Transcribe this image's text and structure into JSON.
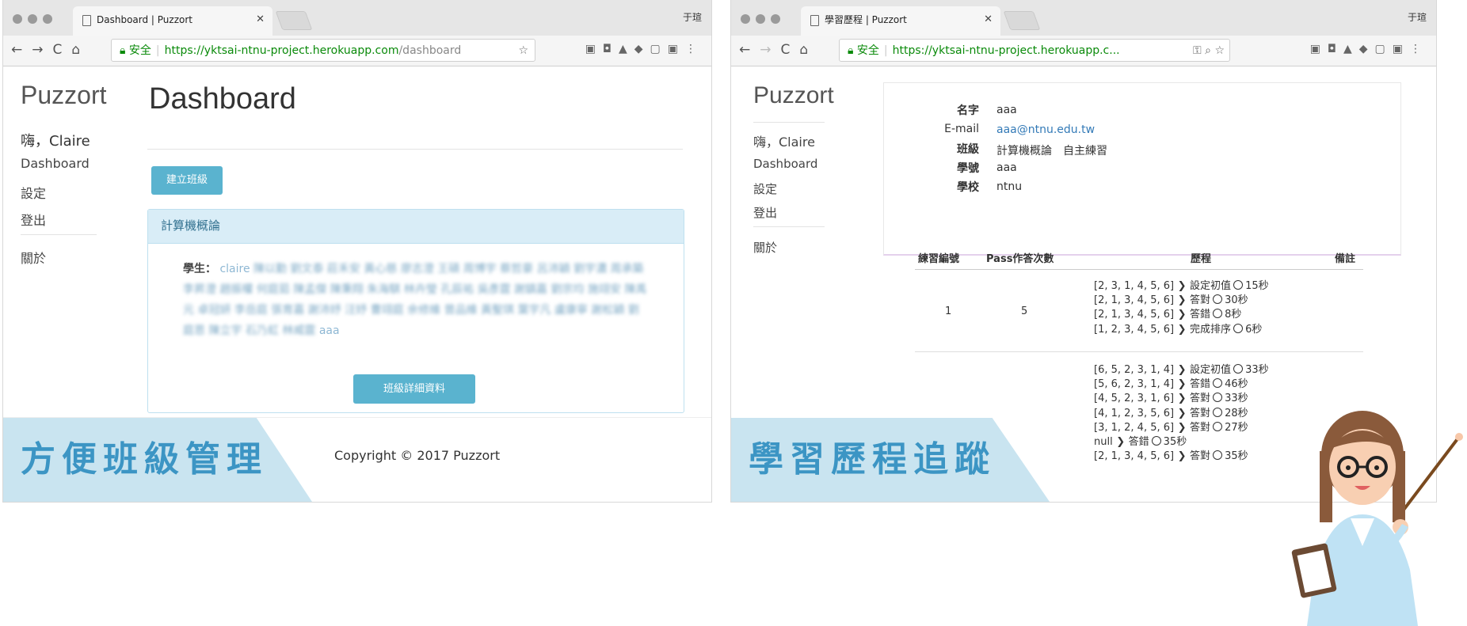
{
  "left": {
    "tab_title": "Dashboard | Puzzort",
    "user_name": "于瑄",
    "url_secure": "安全",
    "url_host": "https://yktsai-ntnu-project.herokuapp.com",
    "url_path": "/dashboard",
    "brand": "Puzzort",
    "greeting": "嗨，Claire",
    "nav": [
      "Dashboard",
      "設定",
      "登出",
      "關於"
    ],
    "page_title": "Dashboard",
    "create_class": "建立班級",
    "panel_title": "計算機概論",
    "students_label": "學生：",
    "students_first": "claire",
    "students_blurred": "陳以勤 劉文泰 莊禾安 黃心慈 廖志澄 王碩 周博宇 蔡哲豪 呂沛穎 劉宇濃 周承築 李昇澄 趙振權 何庭茹 陳孟傑 陳秉翔 朱海騏 林卉瑩 孔辰祐 吳彥霆 謝鎮嘉 劉宗均 施翊安 陳禹元 卓冠妍 李岳庭 張育嘉 謝沛妤 汪妤 曹翊庭 余修維 曾品維 黃聖琪 葉宇凡 盧康寧 謝松穎 劉庭恩 陳立宇 石乃虹 林威霆",
    "students_last": "aaa",
    "class_details": "班級詳細資料",
    "banner": "方便班級管理",
    "copyright": "Copyright © 2017 Puzzort"
  },
  "right": {
    "tab_title": "學習歷程 | Puzzort",
    "user_name": "于瑄",
    "url_secure": "安全",
    "url_text": "https://yktsai-ntnu-project.herokuapp.c...",
    "brand": "Puzzort",
    "greeting": "嗨，Claire",
    "nav": [
      "Dashboard",
      "設定",
      "登出",
      "關於"
    ],
    "profile": {
      "name_label": "名字",
      "name": "aaa",
      "email_label": "E-mail",
      "email": "aaa@ntnu.edu.tw",
      "class_label": "班級",
      "class": "計算機概論　自主練習",
      "id_label": "學號",
      "id": "aaa",
      "school_label": "學校",
      "school": "ntnu"
    },
    "table_headers": [
      "練習編號",
      "Pass作答次數",
      "歷程",
      "備註"
    ],
    "row1": {
      "no": "1",
      "pass": "5",
      "lines": [
        {
          "arr": "[2, 3, 1, 4, 5, 6]",
          "status": "設定初值",
          "time": "15秒"
        },
        {
          "arr": "[2, 1, 3, 4, 5, 6]",
          "status": "答對",
          "time": "30秒"
        },
        {
          "arr": "[2, 1, 3, 4, 5, 6]",
          "status": "答錯",
          "time": "8秒"
        },
        {
          "arr": "[1, 2, 3, 4, 5, 6]",
          "status": "完成排序",
          "time": "6秒"
        }
      ]
    },
    "row2": {
      "lines": [
        {
          "arr": "[6, 5, 2, 3, 1, 4]",
          "status": "設定初值",
          "time": "33秒"
        },
        {
          "arr": "[5, 6, 2, 3, 1, 4]",
          "status": "答錯",
          "time": "46秒"
        },
        {
          "arr": "[4, 5, 2, 3, 1, 6]",
          "status": "答對",
          "time": "33秒"
        },
        {
          "arr": "[4, 1, 2, 3, 5, 6]",
          "status": "答對",
          "time": "28秒"
        },
        {
          "arr": "[3, 1, 2, 4, 5, 6]",
          "status": "答對",
          "time": "27秒"
        },
        {
          "arr": "null",
          "status": "答錯",
          "time": "35秒"
        },
        {
          "arr": "[2, 1, 3, 4, 5, 6]",
          "status": "答對",
          "time": "35秒"
        }
      ]
    },
    "banner": "學習歷程追蹤"
  }
}
